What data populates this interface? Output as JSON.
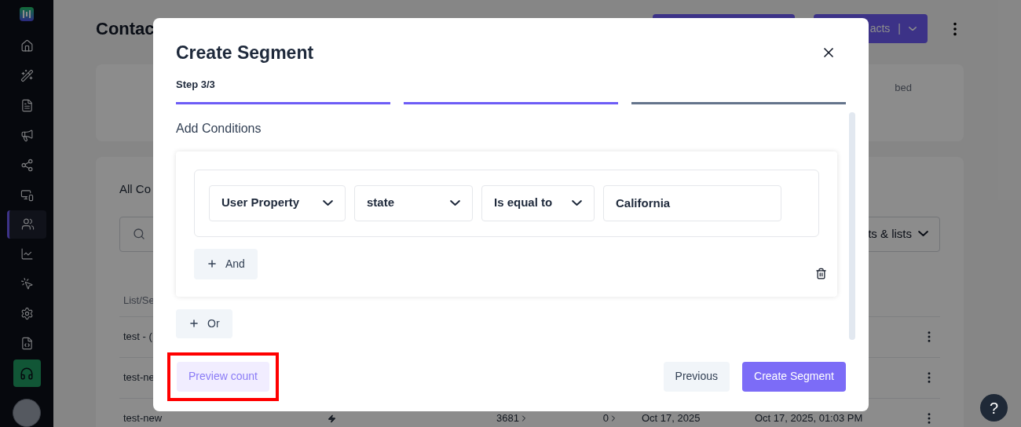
{
  "sidebar": {
    "items": [
      {
        "selected": false
      },
      {
        "selected": false
      },
      {
        "selected": false
      },
      {
        "selected": false
      },
      {
        "selected": false
      },
      {
        "selected": false
      },
      {
        "selected": true
      },
      {
        "selected": false
      },
      {
        "selected": false
      },
      {
        "selected": false
      },
      {
        "selected": false
      }
    ]
  },
  "page": {
    "title": "Contac",
    "header_button": {
      "label": "acts",
      "separator": "|"
    },
    "stats_text": "bed",
    "list_title": "All Co",
    "filter_label": "ts & lists",
    "table_header": "List/Se",
    "rows": [
      {
        "name": "test - (",
        "cells": []
      },
      {
        "name": "test-ne",
        "cells": []
      },
      {
        "name": "test-new",
        "cells": [
          "3681",
          "0",
          "Oct 17, 2025",
          "Oct 17, 2025, 01:03 PM"
        ]
      }
    ]
  },
  "help": {
    "label": "?"
  },
  "modal": {
    "title": "Create Segment",
    "step_label": "Step 3/3",
    "steps": [
      {
        "done": true
      },
      {
        "done": true
      },
      {
        "done": false
      }
    ],
    "section_title": "Add Conditions",
    "condition_fields": [
      {
        "kind": "select",
        "value": "User Property"
      },
      {
        "kind": "select",
        "value": "state"
      },
      {
        "kind": "select",
        "value": "Is equal to"
      },
      {
        "kind": "input",
        "value": "California"
      }
    ],
    "and_button": "And",
    "or_button": "Or",
    "preview_button": "Preview count",
    "highlighted": true,
    "previous_button": "Previous",
    "create_button": "Create Segment"
  }
}
